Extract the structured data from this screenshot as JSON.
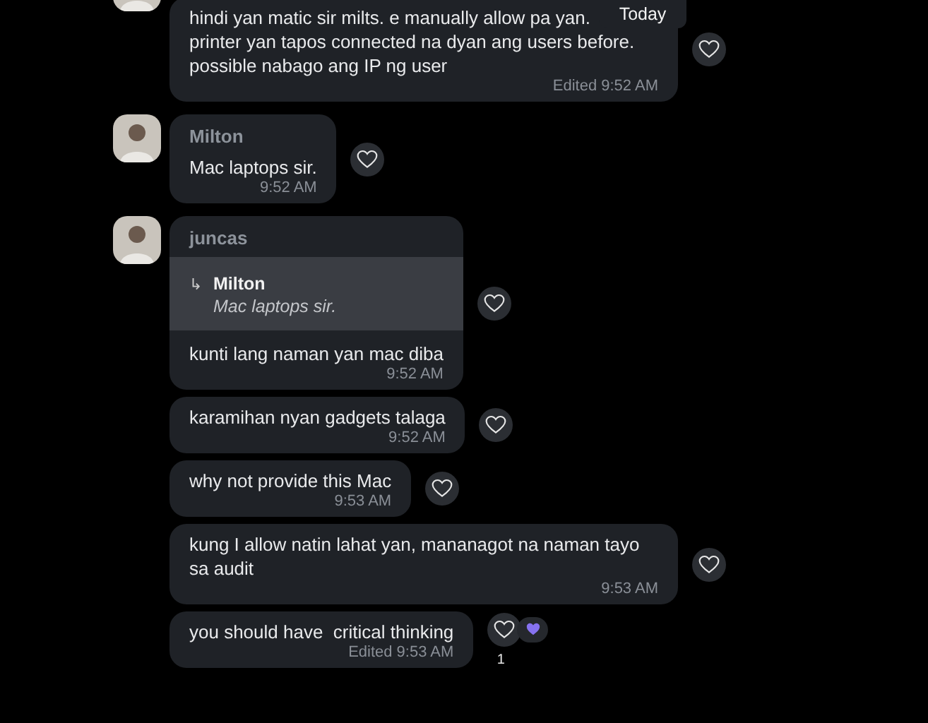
{
  "date_tooltip": "Today",
  "groups": [
    {
      "messages": [
        {
          "lines": [
            "hindi yan matic sir milts. e manually allow pa yan.",
            "printer yan tapos connected na dyan ang users before.",
            "possible nabago ang IP ng user"
          ],
          "time": "Edited 9:52 AM"
        }
      ]
    },
    {
      "author": "Milton",
      "messages": [
        {
          "lines": [
            "Mac laptops sir."
          ],
          "time": "9:52 AM"
        }
      ]
    },
    {
      "author": "juncas",
      "messages": [
        {
          "reply": {
            "author": "Milton",
            "arrow": "↳",
            "text": "Mac laptops sir."
          },
          "lines": [
            "kunti lang naman yan mac diba"
          ],
          "time": "9:52 AM"
        },
        {
          "lines": [
            "karamihan nyan gadgets talaga"
          ],
          "time": "9:52 AM"
        },
        {
          "lines": [
            "why not provide this Mac"
          ],
          "time": "9:53 AM"
        },
        {
          "lines": [
            "kung I allow natin lahat yan, mananagot na naman tayo",
            "sa audit"
          ],
          "time": "9:53 AM"
        },
        {
          "lines": [
            "you should have  critical thinking"
          ],
          "time": "Edited 9:53 AM",
          "reactions": [
            {
              "count": "1"
            }
          ]
        }
      ]
    }
  ]
}
